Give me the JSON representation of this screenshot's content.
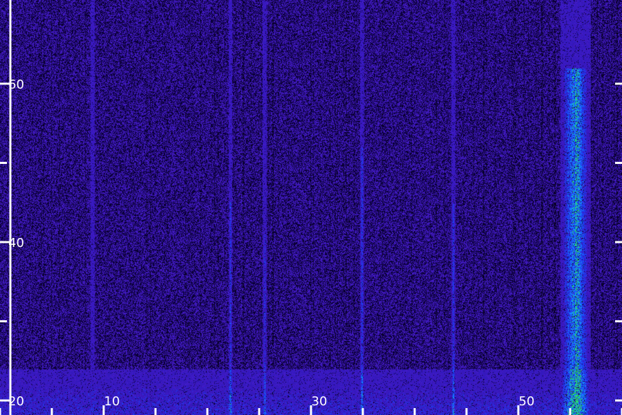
{
  "chart_data": {
    "type": "heatmap",
    "title": "",
    "xlabel": "",
    "ylabel": "",
    "x_ticks": [
      10,
      30,
      50
    ],
    "y_ticks": [
      20,
      40,
      60
    ],
    "xlim": [
      0,
      60
    ],
    "ylim": [
      18,
      62
    ],
    "background_color": "#2a1060",
    "colormap": [
      "#000010",
      "#2a1060",
      "#3a1ab0",
      "#1a3aff",
      "#10a0ff",
      "#20ff60"
    ],
    "features": [
      {
        "kind": "vertical-streak",
        "x": 8.9,
        "y_from": 20,
        "y_to": 62,
        "intensity": 0.05
      },
      {
        "kind": "vertical-streak",
        "x": 22.2,
        "y_from": 20,
        "y_to": 45,
        "intensity": 0.45
      },
      {
        "kind": "vertical-streak",
        "x": 25.5,
        "y_from": 20,
        "y_to": 41,
        "intensity": 0.35
      },
      {
        "kind": "vertical-streak",
        "x": 34.9,
        "y_from": 20,
        "y_to": 52,
        "intensity": 0.4
      },
      {
        "kind": "vertical-streak",
        "x": 43.7,
        "y_from": 20,
        "y_to": 45,
        "intensity": 0.4
      },
      {
        "kind": "vertical-streak",
        "x": 55.5,
        "y_from": 18,
        "y_to": 62,
        "intensity": 0.85
      },
      {
        "kind": "horizontal-band",
        "y_from": 19,
        "y_to": 23,
        "intensity": 0.55
      }
    ],
    "grid": false,
    "legend": "none"
  }
}
